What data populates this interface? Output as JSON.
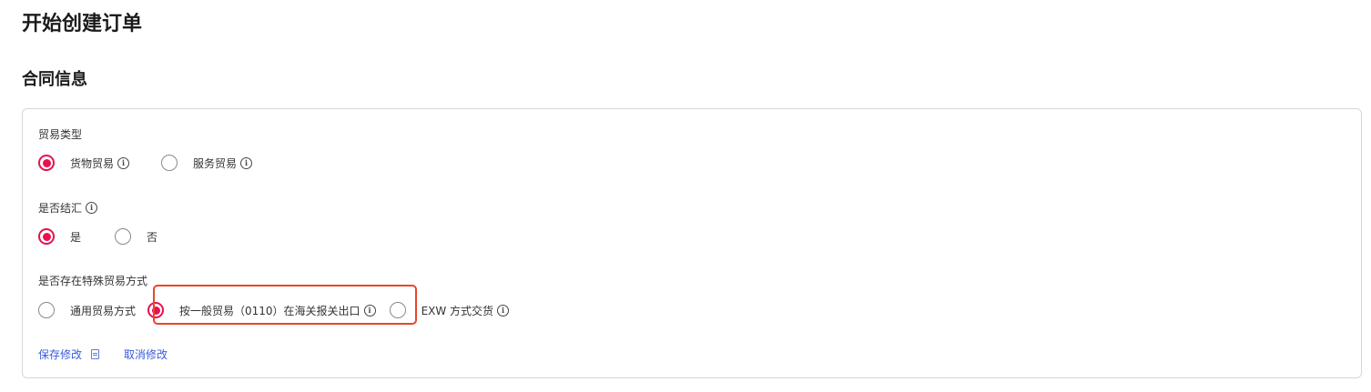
{
  "page": {
    "title": "开始创建订单"
  },
  "section": {
    "title": "合同信息"
  },
  "trade_type": {
    "label": "贸易类型",
    "options": [
      {
        "label": "货物贸易",
        "selected": true,
        "info_icon": "info-icon"
      },
      {
        "label": "服务贸易",
        "selected": false,
        "info_icon": "info-icon"
      }
    ]
  },
  "settlement": {
    "label": "是否结汇",
    "info_icon": "info-icon",
    "options": [
      {
        "label": "是",
        "selected": true
      },
      {
        "label": "否",
        "selected": false
      }
    ]
  },
  "special_trade": {
    "label": "是否存在特殊贸易方式",
    "options": [
      {
        "label": "通用贸易方式",
        "selected": false
      },
      {
        "label": "按一般贸易（0110）在海关报关出口",
        "selected": true,
        "info_icon": "info-icon"
      },
      {
        "label": "EXW 方式交货",
        "selected": false,
        "info_icon": "info-icon"
      }
    ]
  },
  "actions": {
    "save_label": "保存修改",
    "cancel_label": "取消修改",
    "save_icon": "document-icon"
  },
  "colors": {
    "accent": "#e8104f",
    "link": "#3b5bdb",
    "highlight": "#e8452c",
    "border": "#d6d6d6"
  }
}
